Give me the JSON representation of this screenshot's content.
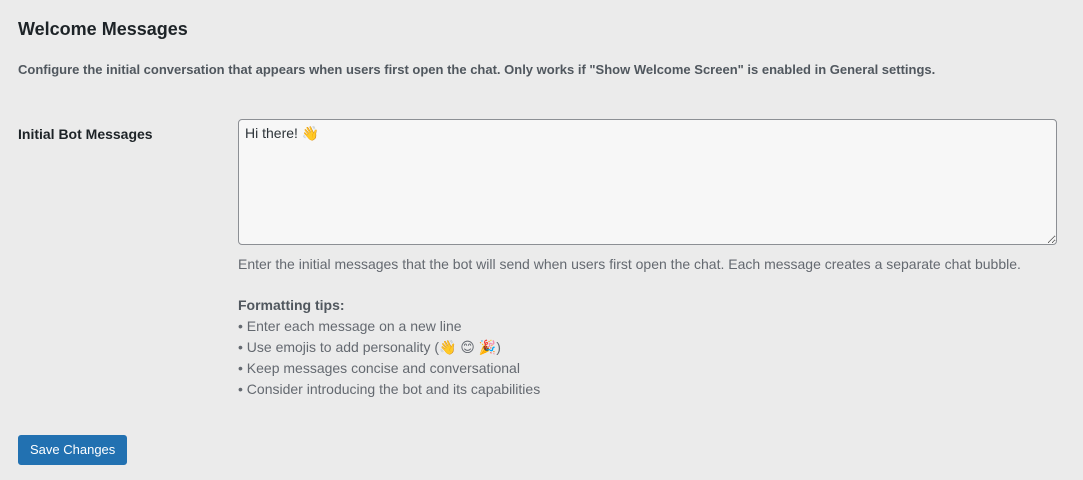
{
  "section": {
    "title": "Welcome Messages",
    "description": "Configure the initial conversation that appears when users first open the chat. Only works if \"Show Welcome Screen\" is enabled in General settings."
  },
  "field": {
    "label": "Initial Bot Messages",
    "value": "Hi there! 👋",
    "help": "Enter the initial messages that the bot will send when users first open the chat. Each message creates a separate chat bubble."
  },
  "tips": {
    "heading": "Formatting tips:",
    "items": [
      "• Enter each message on a new line",
      "• Use emojis to add personality (👋 😊 🎉)",
      "• Keep messages concise and conversational",
      "• Consider introducing the bot and its capabilities"
    ]
  },
  "actions": {
    "save_label": "Save Changes"
  },
  "colors": {
    "primary_button": "#2271b1",
    "background": "#ebebeb"
  }
}
